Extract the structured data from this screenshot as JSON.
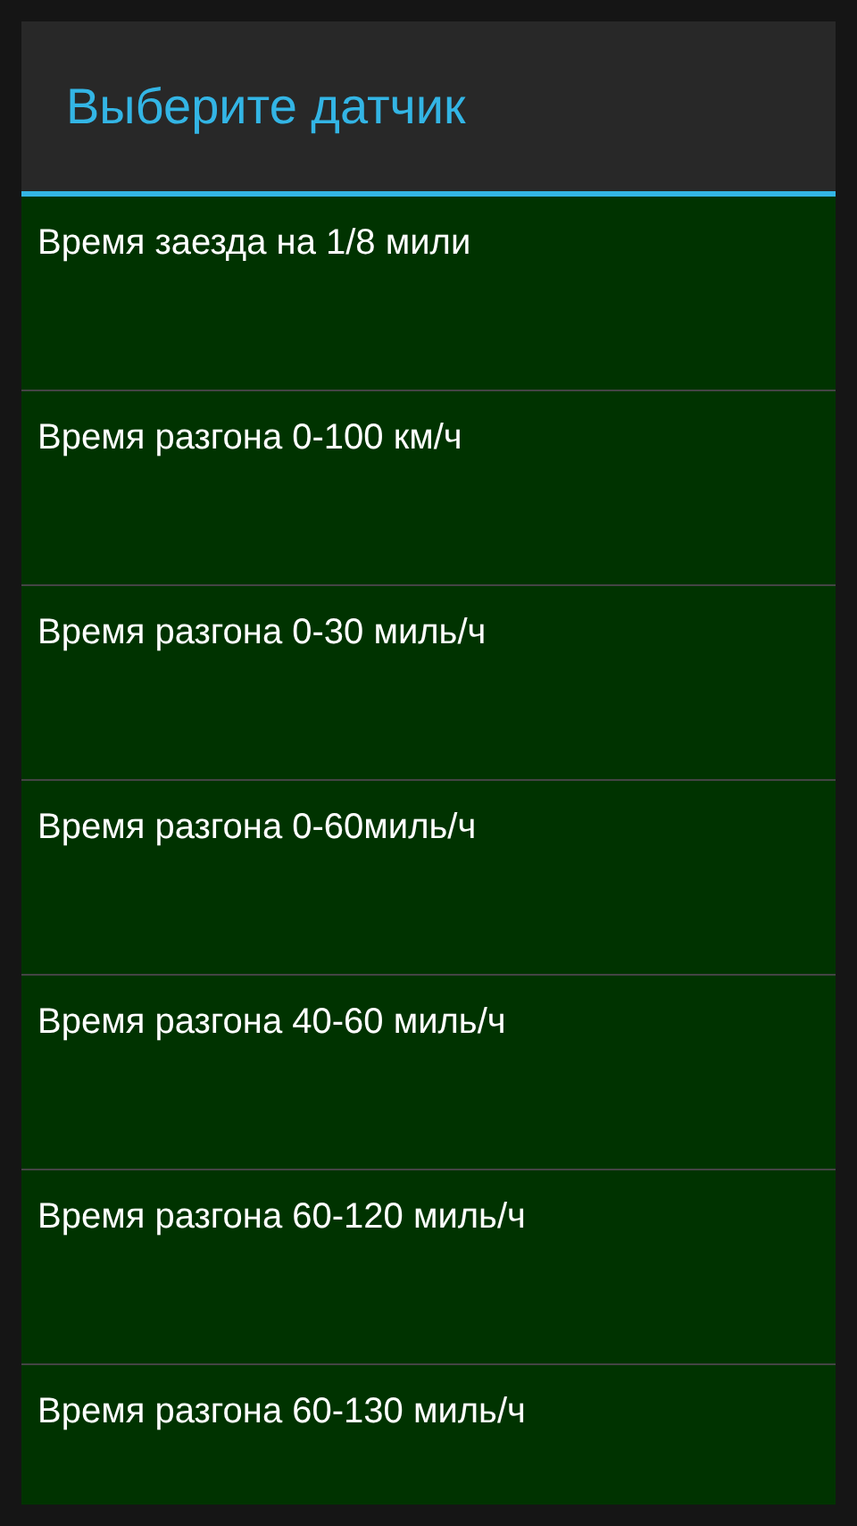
{
  "dialog": {
    "title": "Выберите датчик",
    "items": [
      {
        "label": "Время заезда на 1/8 мили"
      },
      {
        "label": "Время разгона 0-100 км/ч"
      },
      {
        "label": "Время разгона 0-30 миль/ч"
      },
      {
        "label": "Время разгона 0-60миль/ч"
      },
      {
        "label": "Время разгона 40-60 миль/ч"
      },
      {
        "label": "Время разгона 60-120 миль/ч"
      },
      {
        "label": "Время разгона 60-130 миль/ч"
      }
    ]
  }
}
